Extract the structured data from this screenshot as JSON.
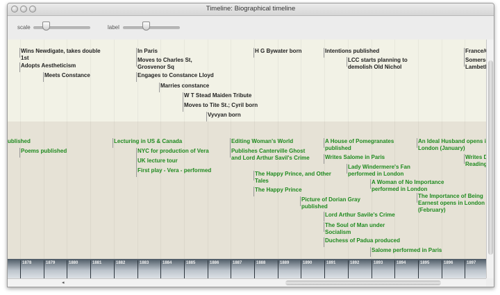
{
  "window": {
    "title": "Timeline: Biographical timeline"
  },
  "toolbar": {
    "scale_label": "scale",
    "label_label": "label"
  },
  "years": [
    "1878",
    "1879",
    "1880",
    "1881",
    "1882",
    "1883",
    "1884",
    "1885",
    "1886",
    "1887",
    "1888",
    "1889",
    "1890",
    "1891",
    "1892",
    "1893",
    "1894",
    "1895",
    "1896",
    "1897"
  ],
  "life_events": [
    {
      "text": "Wins Newdigate, takes double\n1st"
    },
    {
      "text": "Adopts Aestheticism"
    },
    {
      "text": "Meets Constance"
    },
    {
      "text": "In Paris"
    },
    {
      "text": "Moves to Charles St,\nGrosvenor Sq"
    },
    {
      "text": "Engages to Constance Lloyd"
    },
    {
      "text": "Marries constance"
    },
    {
      "text": "W T Stead Maiden Tribute"
    },
    {
      "text": "Moves to Tite St.; Cyril born"
    },
    {
      "text": "Vyvyan born"
    },
    {
      "text": "H G Bywater born"
    },
    {
      "text": "Intentions published"
    },
    {
      "text": "LCC starts planning to\ndemolish Old Nichol"
    },
    {
      "text": "France/O"
    },
    {
      "text": "Somerse\nLambeth"
    }
  ],
  "works_events": [
    {
      "text": "ublished"
    },
    {
      "text": "Poems published"
    },
    {
      "text": "Lecturing in US & Canada"
    },
    {
      "text": "NYC for production of Vera"
    },
    {
      "text": "UK lecture tour"
    },
    {
      "text": "First play - Vera - performed"
    },
    {
      "text": "Editing Woman's World"
    },
    {
      "text": "Publishes Canterville Ghost\nand Lord Arthur Savil's Crime"
    },
    {
      "text": "The Happy Prince, and Other\nTales"
    },
    {
      "text": "The Happy Prince"
    },
    {
      "text": "Picture of Dorian Gray\npublished"
    },
    {
      "text": "A House of Pomegranates\npublished"
    },
    {
      "text": "Writes Salome in Paris"
    },
    {
      "text": "Lady Windermere's Fan\nperformed in London"
    },
    {
      "text": "A Woman of No Importance\nperformed in London"
    },
    {
      "text": "Lord Arthur Savile's Crime"
    },
    {
      "text": "The Soul of Man under\nSocialism"
    },
    {
      "text": "Duchess of Padua produced"
    },
    {
      "text": "Salome performed in Paris"
    },
    {
      "text": "An Ideal Husband opens in\nLondon (January)"
    },
    {
      "text": "The Importance of Being\nEarnest opens in London\n(February)"
    },
    {
      "text": "Writes D\nReading"
    }
  ]
}
